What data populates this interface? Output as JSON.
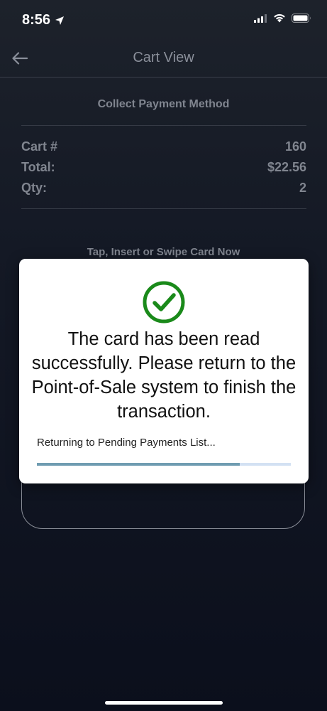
{
  "status_bar": {
    "time": "8:56",
    "icons": [
      "location-arrow-icon",
      "cellular-signal-icon",
      "wifi-icon",
      "battery-icon"
    ]
  },
  "header": {
    "title": "Cart View",
    "back_icon": "arrow-left-icon"
  },
  "main": {
    "section_title": "Collect Payment Method",
    "cart_details": [
      {
        "label": "Cart #",
        "value": "160"
      },
      {
        "label": "Total:",
        "value": "$22.56"
      },
      {
        "label": "Qty:",
        "value": "2"
      }
    ],
    "card_prompt": "Tap, Insert or Swipe Card Now"
  },
  "dialog": {
    "icon": "check-circle-icon",
    "message": "The card has been read successfully. Please return to the Point-of-Sale system to finish the transaction.",
    "status_text": "Returning to Pending Payments List...",
    "progress": 0.8
  },
  "colors": {
    "success_green": "#1a8a1a",
    "progress_fill": "#6f9cb1",
    "progress_track": "#d3e1f3",
    "muted_text": "#80858f"
  }
}
